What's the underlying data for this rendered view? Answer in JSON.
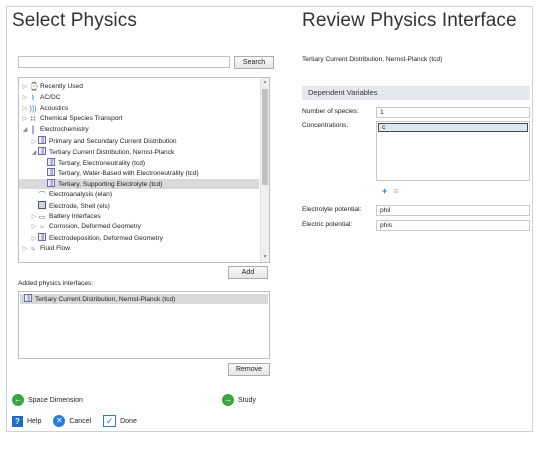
{
  "left": {
    "title": "Select Physics",
    "search": {
      "value": "",
      "button": "Search"
    },
    "tree": [
      {
        "label": "Recently Used",
        "arrow": "▷",
        "icon": "recent-icon",
        "glyph": "⌚",
        "indent": 0
      },
      {
        "label": "AC/DC",
        "arrow": "▷",
        "icon": "acdc-icon",
        "glyph": "⌇",
        "indent": 0
      },
      {
        "label": "Acoustics",
        "arrow": "▷",
        "icon": "acoustics-icon",
        "glyph": ")))",
        "indent": 0
      },
      {
        "label": "Chemical Species Transport",
        "arrow": "▷",
        "icon": "chemical-icon",
        "glyph": "∷",
        "indent": 0
      },
      {
        "label": "Electrochemistry",
        "arrow": "◢",
        "icon": "electrochemistry-icon",
        "glyph": "║",
        "indent": 0
      },
      {
        "label": "Primary and Secondary Current Distribution",
        "arrow": "▷",
        "icon": "current-distribution-icon",
        "glyph": "",
        "indent": 1
      },
      {
        "label": "Tertiary Current Distribution, Nernst-Planck",
        "arrow": "◢",
        "icon": "tertiary-icon",
        "glyph": "",
        "indent": 1
      },
      {
        "label": "Tertiary, Electroneutrality (tcd)",
        "arrow": "",
        "icon": "tcd-icon",
        "glyph": "",
        "indent": 2
      },
      {
        "label": "Tertiary, Water-Based with Electroneutrality (tcd)",
        "arrow": "",
        "icon": "tcd-icon",
        "glyph": "",
        "indent": 2
      },
      {
        "label": "Tertiary, Supporting Electrolyte (tcd)",
        "arrow": "",
        "icon": "tcd-icon",
        "glyph": "",
        "indent": 2,
        "selected": true
      },
      {
        "label": "Electroanalysis (elan)",
        "arrow": "",
        "icon": "electroanalysis-icon",
        "glyph": "⌒",
        "indent": 1
      },
      {
        "label": "Electrode, Shell (els)",
        "arrow": "",
        "icon": "electrode-shell-icon",
        "glyph": "",
        "indent": 1
      },
      {
        "label": "Battery Interfaces",
        "arrow": "▷",
        "icon": "battery-icon",
        "glyph": "▭",
        "indent": 1
      },
      {
        "label": "Corrosion, Deformed Geometry",
        "arrow": "▷",
        "icon": "corrosion-icon",
        "glyph": "≈",
        "indent": 1
      },
      {
        "label": "Electrodeposition, Deformed Geometry",
        "arrow": "▷",
        "icon": "electrodeposition-icon",
        "glyph": "",
        "indent": 1
      },
      {
        "label": "Fluid Flow",
        "arrow": "▷",
        "icon": "fluid-flow-icon",
        "glyph": "≈",
        "indent": 0
      }
    ],
    "add_button": "Add",
    "added_label": "Added physics interfaces:",
    "added_items": [
      "Tertiary Current Distribution, Nernst-Planck (tcd)"
    ],
    "remove_button": "Remove",
    "nav_back": "Space Dimension",
    "nav_next": "Study",
    "help": "Help",
    "cancel": "Cancel",
    "done": "Done"
  },
  "right": {
    "title": "Review Physics Interface",
    "subtitle": "Tertiary Current Distribution, Nernst-Planck (tcd)",
    "section": "Dependent Variables",
    "number_of_species_label": "Number of species:",
    "number_of_species_value": "1",
    "concentrations_label": "Concentrations:",
    "concentrations": [
      "c"
    ],
    "electrolyte_label": "Electrolyte potential:",
    "electrolyte_value": "phil",
    "electric_label": "Electric potential:",
    "electric_value": "phis"
  },
  "colors": {
    "selection": "#d9d9d9",
    "header_band": "#e5e9ef",
    "nav_green": "#3da53d",
    "accent_blue": "#2a7ad8"
  }
}
